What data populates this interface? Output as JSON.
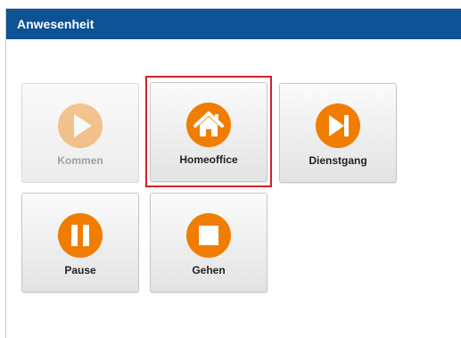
{
  "panel": {
    "title": "Anwesenheit"
  },
  "colors": {
    "header_bg": "#0c5294",
    "icon_orange": "#f07d00",
    "selected_border": "#d42127"
  },
  "buttons": [
    {
      "label": "Kommen",
      "icon": "play-icon",
      "enabled": false
    },
    {
      "label": "Homeoffice",
      "icon": "home-icon",
      "enabled": true,
      "selected": true
    },
    {
      "label": "Dienstgang",
      "icon": "skip-next-icon",
      "enabled": true
    },
    {
      "label": "Pause",
      "icon": "pause-icon",
      "enabled": true
    },
    {
      "label": "Gehen",
      "icon": "stop-icon",
      "enabled": true
    }
  ]
}
